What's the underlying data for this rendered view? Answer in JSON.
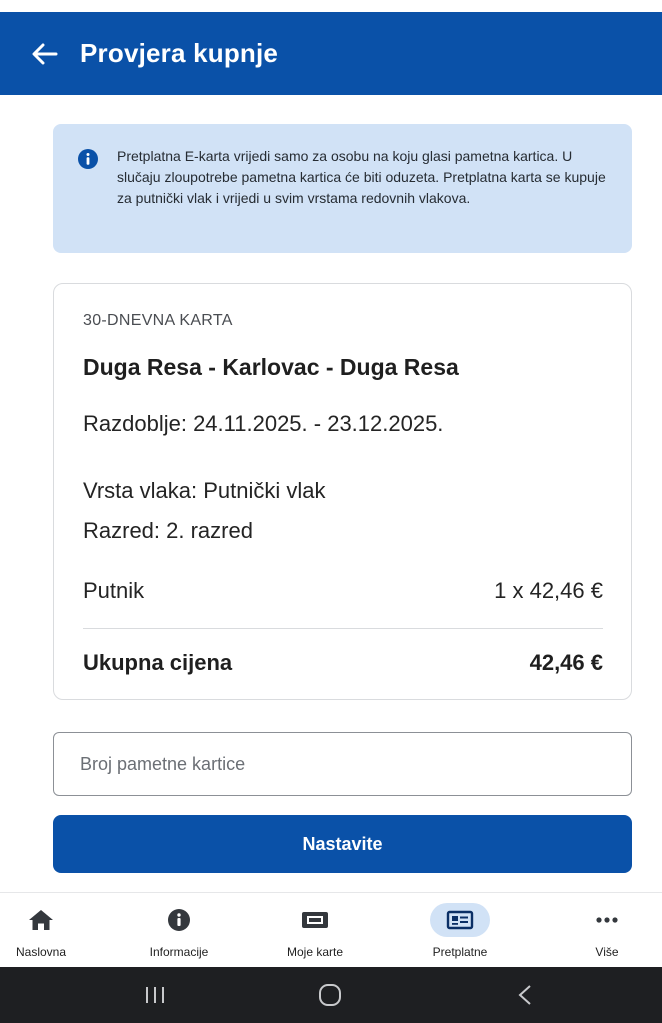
{
  "header": {
    "title": "Provjera kupnje",
    "back_icon": "arrow-left-icon"
  },
  "info": {
    "icon": "info-icon",
    "text": "Pretplatna E-karta vrijedi samo za osobu na koju glasi pametna kartica. U slučaju zloupotrebe pametna kartica će biti oduzeta. Pretplatna karta se kupuje za putnički vlak i vrijedi u svim vrstama redovnih vlakova."
  },
  "ticket": {
    "type": "30-DNEVNA KARTA",
    "route": "Duga Resa - Karlovac - Duga Resa",
    "period": "Razdoblje: 24.11.2025. - 23.12.2025.",
    "train_type": "Vrsta vlaka: Putnički vlak",
    "class": "Razred: 2. razred",
    "passenger_label": "Putnik",
    "passenger_value": "1 x 42,46 €",
    "total_label": "Ukupna cijena",
    "total_value": "42,46 €"
  },
  "card_input": {
    "placeholder": "Broj pametne kartice",
    "value": ""
  },
  "continue_button": {
    "label": "Nastavite"
  },
  "bottom_nav": {
    "items": [
      {
        "label": "Naslovna",
        "icon": "home-icon"
      },
      {
        "label": "Informacije",
        "icon": "info-icon"
      },
      {
        "label": "Moje karte",
        "icon": "ticket-icon"
      },
      {
        "label": "Pretplatne",
        "icon": "id-card-icon",
        "active": true
      },
      {
        "label": "Više",
        "icon": "more-icon"
      }
    ]
  },
  "colors": {
    "primary": "#0a51a8",
    "info_background": "#d1e2f6",
    "system_nav": "#1e1f22"
  }
}
